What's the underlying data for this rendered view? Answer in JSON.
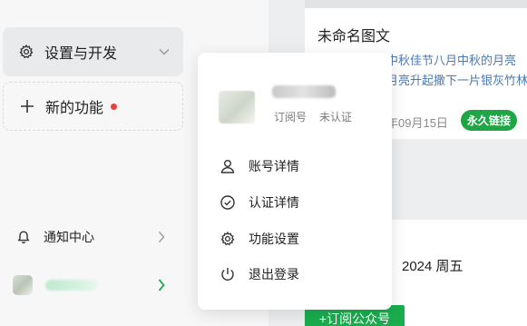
{
  "sidebar": {
    "settings_label": "设置与开发",
    "new_feature_label": "新的功能",
    "notify_label": "通知中心"
  },
  "article": {
    "title": "未命名图文",
    "line1": "中秋佳节八月中秋的月亮",
    "line2": "月亮升起撒下一片银灰竹林",
    "date": "年09月15日",
    "badge": "永久链接"
  },
  "lower": {
    "date_text": "2024  周五",
    "subscribe_label": "+订阅公众号"
  },
  "popup": {
    "account_type": "订阅号",
    "verify_status": "未认证",
    "items": [
      {
        "label": "账号详情",
        "icon": "user-icon"
      },
      {
        "label": "认证详情",
        "icon": "check-circle-icon"
      },
      {
        "label": "功能设置",
        "icon": "gear-icon"
      },
      {
        "label": "退出登录",
        "icon": "power-icon"
      }
    ]
  },
  "colors": {
    "accent_green": "#1aad4e",
    "badge_green": "#1ea545",
    "dot_red": "#e63f3f",
    "link_blue": "#4a79b5"
  }
}
